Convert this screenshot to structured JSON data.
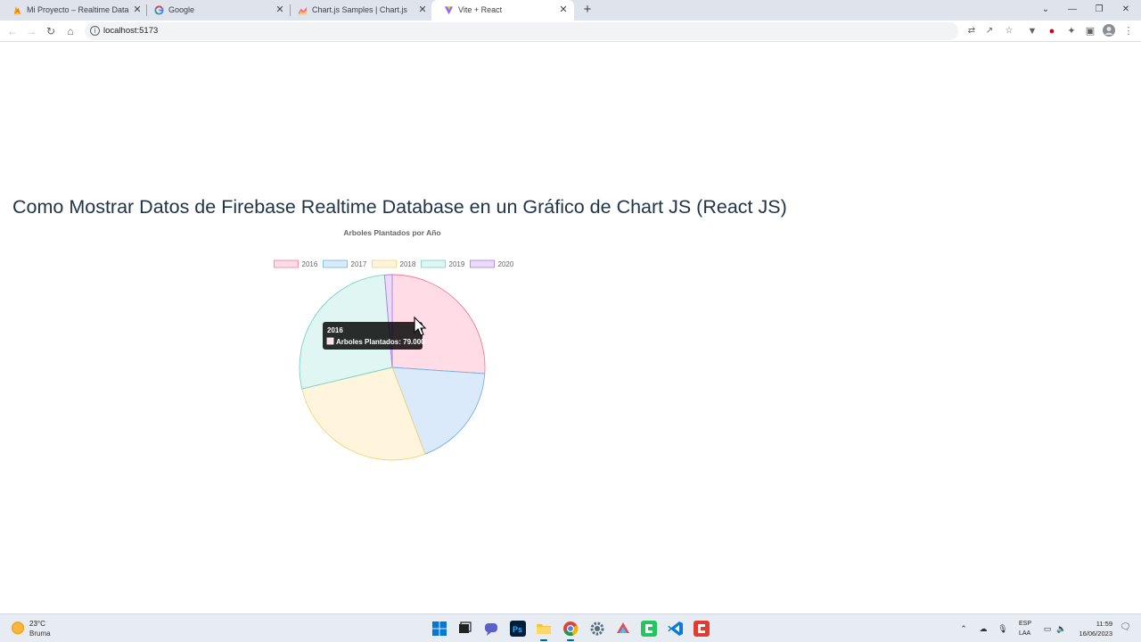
{
  "browser": {
    "tabs": [
      {
        "title": "Mi Proyecto – Realtime Database",
        "favicon": "firebase-icon",
        "active": false
      },
      {
        "title": "Google",
        "favicon": "google-icon",
        "active": false
      },
      {
        "title": "Chart.js Samples | Chart.js",
        "favicon": "chartjs-icon",
        "active": false
      },
      {
        "title": "Vite + React",
        "favicon": "vite-icon",
        "active": true
      }
    ],
    "new_tab_label": "+",
    "address": "localhost:5173"
  },
  "page": {
    "title": "Como Mostrar Datos de Firebase Realtime Database en un Gráfico de Chart JS (React JS)"
  },
  "chart_data": {
    "type": "pie",
    "title": "Arboles Plantados por Año",
    "legend_position": "top",
    "series_name": "Arboles Plantados",
    "categories": [
      "2016",
      "2017",
      "2018",
      "2019",
      "2020"
    ],
    "values": [
      79000,
      55000,
      82000,
      83000,
      4000
    ],
    "colors": {
      "fill": [
        "#ffdce6",
        "#dbeafb",
        "#fff5dc",
        "#dff6f3",
        "#ecdcfb"
      ],
      "border": [
        "#f37a96",
        "#6fb2e8",
        "#f5d27a",
        "#7bd0c6",
        "#a87fee"
      ]
    },
    "tooltip": {
      "title": "2016",
      "label": "Arboles Plantados: 79.000"
    }
  },
  "taskbar": {
    "weather_temp": "23°C",
    "weather_desc": "Bruma",
    "lang_top": "ESP",
    "lang_bottom": "LAA",
    "time": "11:59",
    "date": "16/06/2023"
  }
}
